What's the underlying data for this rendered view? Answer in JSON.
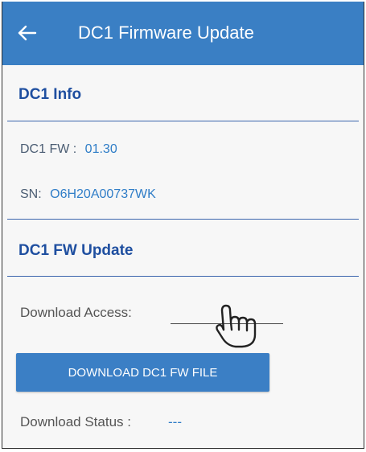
{
  "header": {
    "title": "DC1 Firmware Update",
    "back_icon": "arrow-left-icon",
    "background": "#3a7fc4"
  },
  "info": {
    "section_title": "DC1 Info",
    "fw_label": "DC1 FW :",
    "fw_value": "01.30",
    "sn_label": "SN:",
    "sn_value": "O6H20A00737WK"
  },
  "update": {
    "section_title": "DC1 FW Update",
    "download_access_label": "Download Access:",
    "download_access_value": "",
    "download_button_label": "DOWNLOAD DC1 FW FILE",
    "download_status_label": "Download Status :",
    "download_status_value": "---"
  },
  "pointer": {
    "icon": "hand-pointer-icon"
  },
  "colors": {
    "accent": "#3a7fc4",
    "section_title": "#1f4fa0",
    "value": "#2f7dc7"
  }
}
